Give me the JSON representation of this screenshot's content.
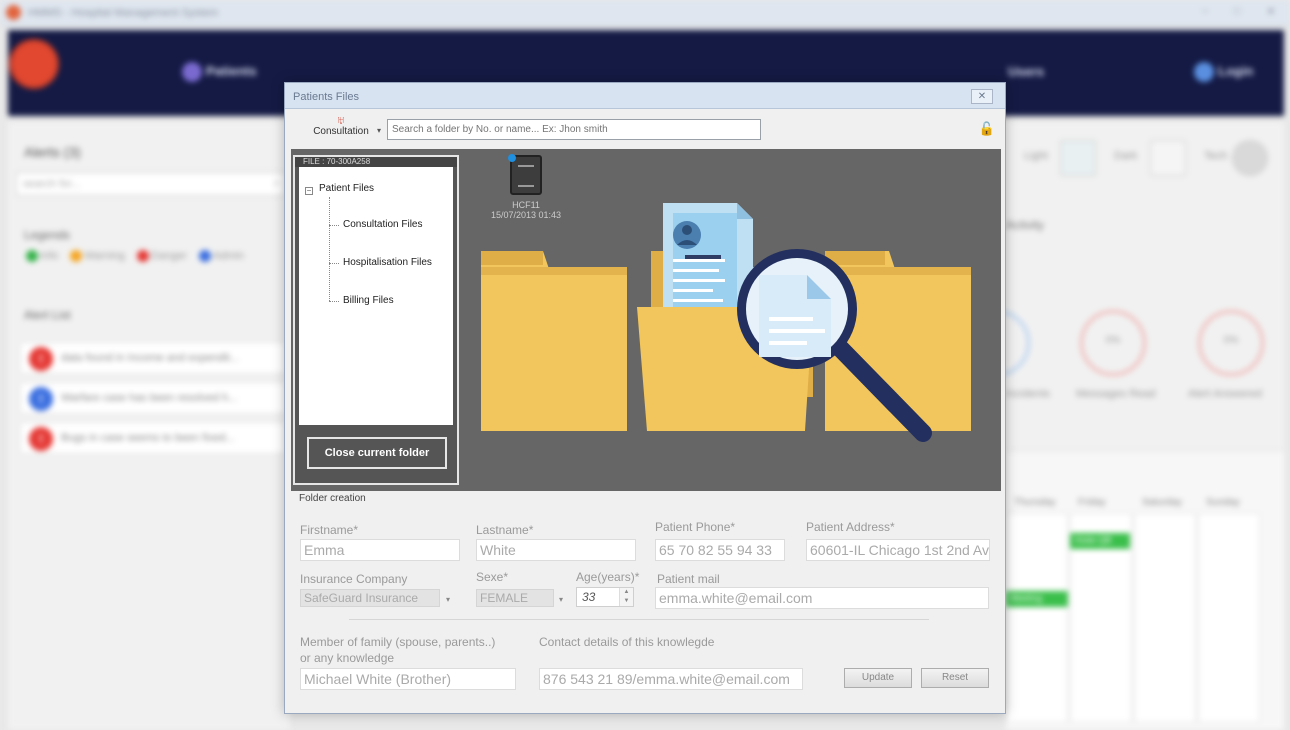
{
  "app": {
    "title": "HMMS - Hospital Management System",
    "nav": {
      "patients_label": "Patients",
      "right_item_label": "Users",
      "login_label": "Login"
    }
  },
  "alerts_panel": {
    "title": "Alerts (3)",
    "search_placeholder": "search for...",
    "legends_title": "Legends",
    "legends": [
      {
        "label": "Info",
        "color": "#35b34a"
      },
      {
        "label": "Warning",
        "color": "#f5a623"
      },
      {
        "label": "Danger",
        "color": "#e53935"
      },
      {
        "label": "Admin",
        "color": "#3b6fe0"
      }
    ],
    "alert_list_title": "Alert List",
    "alerts": [
      {
        "text": "data found in Income and expendit...",
        "color": "#e53935"
      },
      {
        "text": "Warfare case has been resolved h...",
        "color": "#3b6fe0"
      },
      {
        "text": "Bugs in case seems to been fixed...",
        "color": "#e53935"
      }
    ]
  },
  "right_panel": {
    "themes": [
      {
        "label": "Light"
      },
      {
        "label": "Dark"
      },
      {
        "label": "Tech"
      }
    ],
    "activity_title": "Activity",
    "stats": [
      {
        "label": "Incidents",
        "value": ""
      },
      {
        "label": "Messages Read",
        "value": "0%"
      },
      {
        "label": "Alert Answered",
        "value": "0%"
      }
    ],
    "calendar": {
      "days": [
        "Thursday",
        "Friday",
        "Saturday",
        "Sunday"
      ],
      "events": [
        "Meeting",
        "Visite QB"
      ]
    }
  },
  "dialog": {
    "title": "Patients Files",
    "close_glyph": "✕",
    "toolbar": {
      "consultation_label": "Consultation",
      "search_placeholder": "Search a folder by No. or name... Ex: Jhon smith"
    },
    "tree": {
      "header": "FILE : 70-300A258",
      "root": "Patient Files",
      "children": [
        "Consultation Files",
        "Hospitalisation Files",
        "Billing Files"
      ]
    },
    "close_folder_label": "Close current folder",
    "file": {
      "name": "HCF11",
      "date": "15/07/2013 01:43"
    },
    "section_label": "Folder creation",
    "form": {
      "firstname_label": "Firstname*",
      "firstname_value": "Emma",
      "lastname_label": "Lastname*",
      "lastname_value": "White",
      "phone_label": "Patient Phone*",
      "phone_value": "65 70 82 55 94 33",
      "address_label": "Patient Address*",
      "address_value": "60601-IL Chicago 1st 2nd Av",
      "insurance_label": "Insurance Company",
      "insurance_value": "SafeGuard Insurance",
      "sex_label": "Sexe*",
      "sex_value": "FEMALE",
      "age_label": "Age(years)*",
      "age_value": "33",
      "mail_label": "Patient mail",
      "mail_value": "emma.white@email.com",
      "family_label_1": "Member of family (spouse, parents..)",
      "family_label_2": "or any knowledge",
      "family_value": "Michael White (Brother)",
      "contact_label": "Contact details of this knowlegde",
      "contact_value": "876 543 21 89/emma.white@email.com"
    },
    "update_label": "Update",
    "reset_label": "Reset"
  }
}
